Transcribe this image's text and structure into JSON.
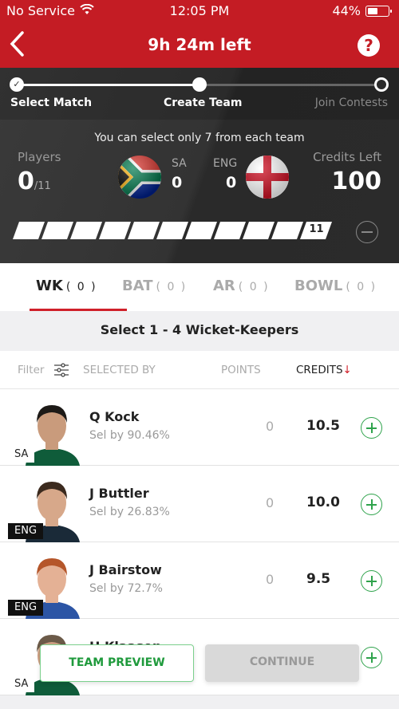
{
  "status_bar": {
    "carrier": "No Service",
    "time": "12:05 PM",
    "battery": "44%",
    "battery_level": 0.44
  },
  "header": {
    "title": "9h 24m left",
    "help": "?"
  },
  "stepper": {
    "steps": [
      {
        "label": "Select Match",
        "state": "done"
      },
      {
        "label": "Create Team",
        "state": "current"
      },
      {
        "label": "Join Contests",
        "state": "pending"
      }
    ]
  },
  "team_summary": {
    "notice": "You can select only 7 from each team",
    "players_label": "Players",
    "players_selected": "0",
    "players_total": "/11",
    "team1": {
      "code": "SA",
      "count": "0"
    },
    "team2": {
      "code": "ENG",
      "count": "0"
    },
    "credits_label": "Credits Left",
    "credits_value": "100",
    "progress_total_label": "11",
    "progress_filled": 0
  },
  "tabs": [
    {
      "label": "WK",
      "count": "( 0 )",
      "active": true
    },
    {
      "label": "BAT",
      "count": "( 0 )",
      "active": false
    },
    {
      "label": "AR",
      "count": "( 0 )",
      "active": false
    },
    {
      "label": "BOWL",
      "count": "( 0 )",
      "active": false
    }
  ],
  "subtitle": "Select 1 - 4 Wicket-Keepers",
  "columns": {
    "filter": "Filter",
    "selected_by": "SELECTED BY",
    "points": "POINTS",
    "credits": "CREDITS",
    "sort_arrow": "↓"
  },
  "players": [
    {
      "name": "Q Kock",
      "sel": "Sel by 90.46%",
      "team": "SA",
      "points": "0",
      "credits": "10.5"
    },
    {
      "name": "J Buttler",
      "sel": "Sel by 26.83%",
      "team": "ENG",
      "points": "0",
      "credits": "10.0"
    },
    {
      "name": "J Bairstow",
      "sel": "Sel by 72.7%",
      "team": "ENG",
      "points": "0",
      "credits": "9.5"
    },
    {
      "name": "H Klaasen",
      "sel": "",
      "team": "SA",
      "points": "",
      "credits": ""
    }
  ],
  "buttons": {
    "team_preview": "TEAM PREVIEW",
    "continue": "CONTINUE"
  },
  "colors": {
    "brand_red": "#c41c24",
    "accent_green": "#2fa34c",
    "dark_panel": "#2f2f2f"
  }
}
